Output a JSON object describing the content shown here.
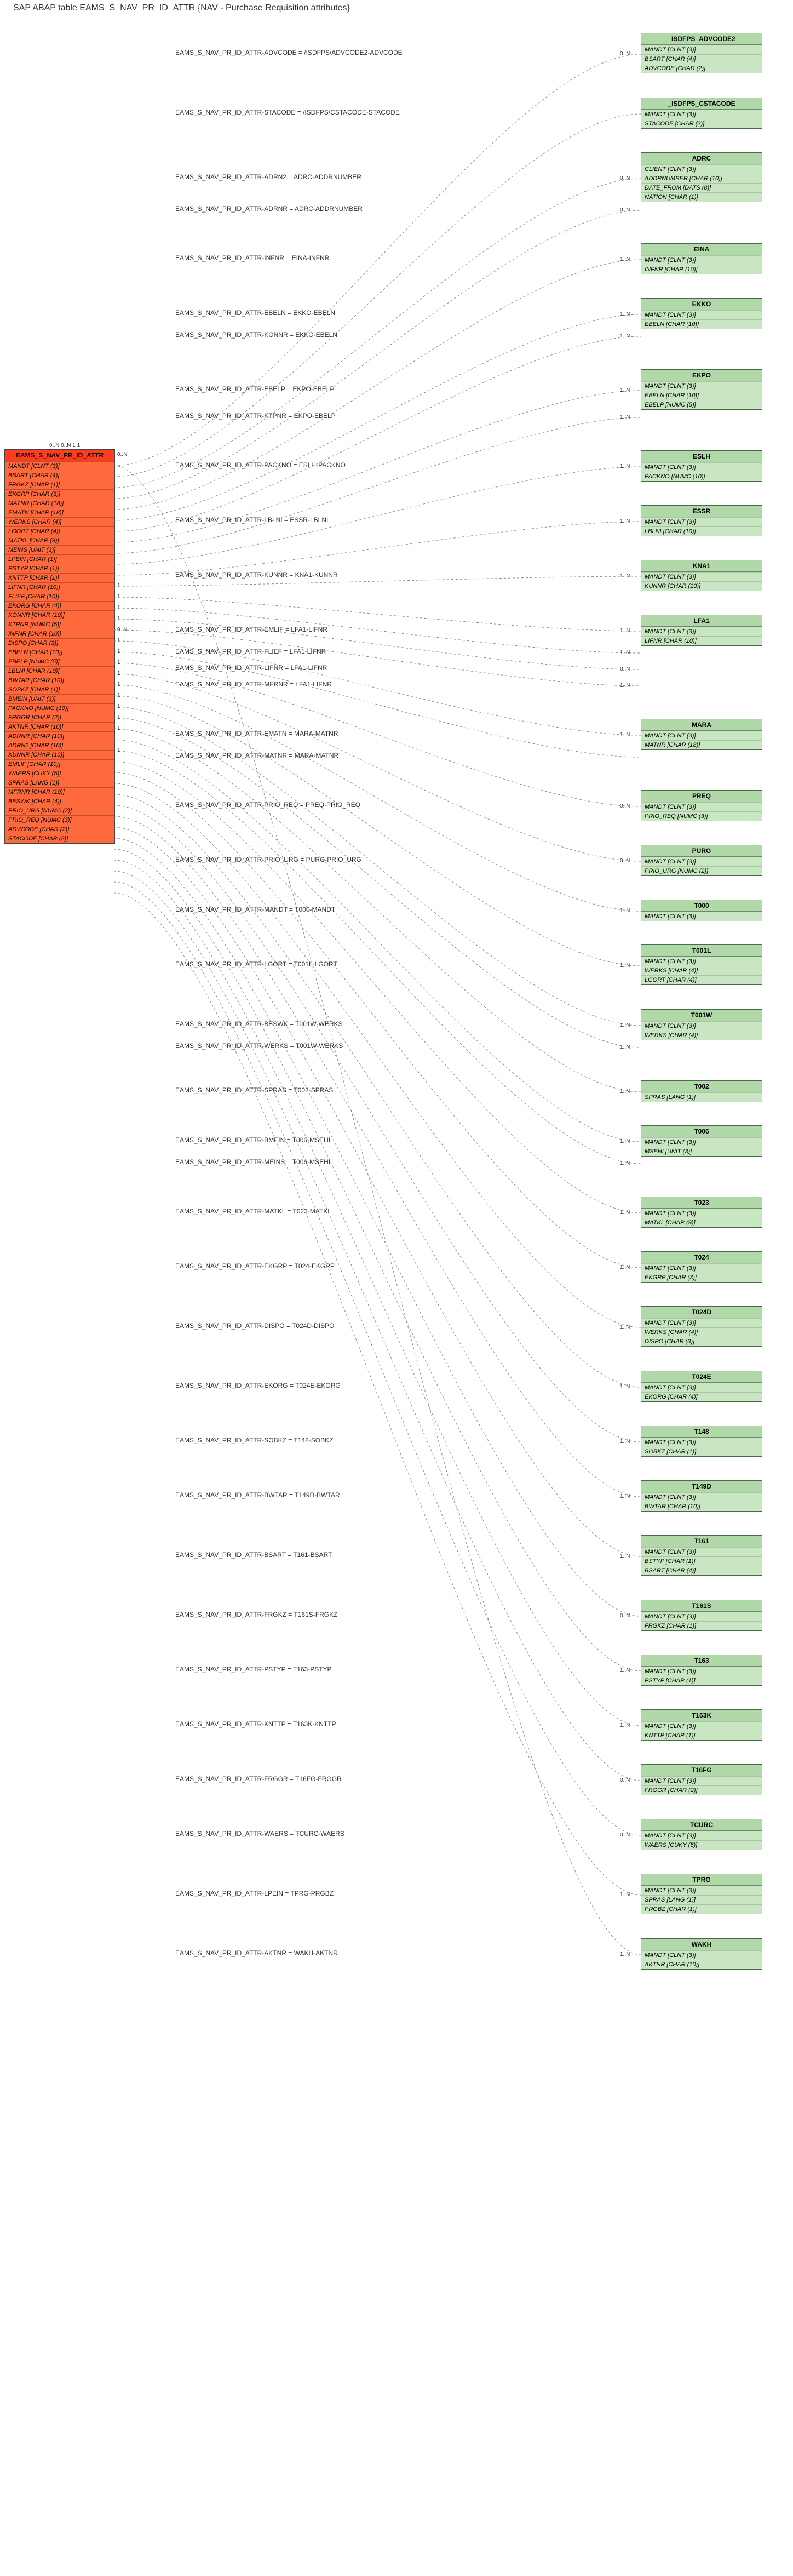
{
  "page_title": "SAP ABAP table EAMS_S_NAV_PR_ID_ATTR {NAV - Purchase Requisition attributes}",
  "main_table": {
    "name": "EAMS_S_NAV_PR_ID_ATTR",
    "fields": [
      "MANDT [CLNT (3)]",
      "BSART [CHAR (4)]",
      "FRGKZ [CHAR (1)]",
      "EKGRP [CHAR (3)]",
      "MATNR [CHAR (18)]",
      "EMATN [CHAR (18)]",
      "WERKS [CHAR (4)]",
      "LGORT [CHAR (4)]",
      "MATKL [CHAR (9)]",
      "MEINS [UNIT (3)]",
      "LPEIN [CHAR (1)]",
      "PSTYP [CHAR (1)]",
      "KNTTP [CHAR (1)]",
      "LIFNR [CHAR (10)]",
      "FLIEF [CHAR (10)]",
      "EKORG [CHAR (4)]",
      "KONNR [CHAR (10)]",
      "KTPNR [NUMC (5)]",
      "INFNR [CHAR (10)]",
      "DISPO [CHAR (3)]",
      "EBELN [CHAR (10)]",
      "EBELP [NUMC (5)]",
      "LBLNI [CHAR (10)]",
      "BWTAR [CHAR (10)]",
      "SOBKZ [CHAR (1)]",
      "BMEIN [UNIT (3)]",
      "PACKNO [NUMC (10)]",
      "FRGGR [CHAR (2)]",
      "AKTNR [CHAR (10)]",
      "ADRNR [CHAR (10)]",
      "ADRN2 [CHAR (10)]",
      "KUNNR [CHAR (10)]",
      "EMLIF [CHAR (10)]",
      "WAERS [CUKY (5)]",
      "SPRAS [LANG (1)]",
      "MFRNR [CHAR (10)]",
      "BESWK [CHAR (4)]",
      "PRIO_URG [NUMC (2)]",
      "PRIO_REQ [NUMC (3)]",
      "ADVCODE [CHAR (2)]",
      "STACODE [CHAR (2)]"
    ]
  },
  "relations": [
    {
      "label": "EAMS_S_NAV_PR_ID_ATTR-ADVCODE = /ISDFPS/ADVCODE2-ADVCODE",
      "card_src": "0..N",
      "card_tgt": "0..N",
      "target": {
        "name": "_ISDFPS_ADVCODE2",
        "fields": [
          "MANDT [CLNT (3)]",
          "BSART [CHAR (4)]",
          "ADVCODE [CHAR (2)]"
        ]
      }
    },
    {
      "label": "EAMS_S_NAV_PR_ID_ATTR-STACODE = /ISDFPS/CSTACODE-STACODE",
      "card_src": "",
      "card_tgt": "",
      "target": {
        "name": "_ISDFPS_CSTACODE",
        "fields": [
          "MANDT [CLNT (3)]",
          "STACODE [CHAR (2)]"
        ]
      }
    },
    {
      "label": "EAMS_S_NAV_PR_ID_ATTR-ADRN2 = ADRC-ADDRNUMBER",
      "card_src": "",
      "card_tgt": "0..N",
      "target": {
        "name": "ADRC",
        "fields": [
          "CLIENT [CLNT (3)]",
          "ADDRNUMBER [CHAR (10)]",
          "DATE_FROM [DATS (8)]",
          "NATION [CHAR (1)]"
        ]
      }
    },
    {
      "label": "EAMS_S_NAV_PR_ID_ATTR-ADRNR = ADRC-ADDRNUMBER",
      "card_src": "",
      "card_tgt": "0..N",
      "target": null
    },
    {
      "label": "EAMS_S_NAV_PR_ID_ATTR-INFNR = EINA-INFNR",
      "card_src": "",
      "card_tgt": "1..N",
      "target": {
        "name": "EINA",
        "fields": [
          "MANDT [CLNT (3)]",
          "INFNR [CHAR (10)]"
        ]
      }
    },
    {
      "label": "EAMS_S_NAV_PR_ID_ATTR-EBELN = EKKO-EBELN",
      "card_src": "",
      "card_tgt": "1..N",
      "target": {
        "name": "EKKO",
        "fields": [
          "MANDT [CLNT (3)]",
          "EBELN [CHAR (10)]"
        ]
      }
    },
    {
      "label": "EAMS_S_NAV_PR_ID_ATTR-KONNR = EKKO-EBELN",
      "card_src": "",
      "card_tgt": "1..N",
      "target": null
    },
    {
      "label": "EAMS_S_NAV_PR_ID_ATTR-EBELP = EKPO-EBELP",
      "card_src": "",
      "card_tgt": "1..N",
      "target": {
        "name": "EKPO",
        "fields": [
          "MANDT [CLNT (3)]",
          "EBELN [CHAR (10)]",
          "EBELP [NUMC (5)]"
        ]
      }
    },
    {
      "label": "EAMS_S_NAV_PR_ID_ATTR-KTPNR = EKPO-EBELP",
      "card_src": "",
      "card_tgt": "1..N",
      "target": null
    },
    {
      "label": "EAMS_S_NAV_PR_ID_ATTR-PACKNO = ESLH-PACKNO",
      "card_src": "",
      "card_tgt": "1..N",
      "target": {
        "name": "ESLH",
        "fields": [
          "MANDT [CLNT (3)]",
          "PACKNO [NUMC (10)]"
        ]
      }
    },
    {
      "label": "EAMS_S_NAV_PR_ID_ATTR-LBLNI = ESSR-LBLNI",
      "card_src": "",
      "card_tgt": "1..N",
      "target": {
        "name": "ESSR",
        "fields": [
          "MANDT [CLNT (3)]",
          "LBLNI [CHAR (10)]"
        ]
      }
    },
    {
      "label": "EAMS_S_NAV_PR_ID_ATTR-KUNNR = KNA1-KUNNR",
      "card_src": "",
      "card_tgt": "1..N",
      "target": {
        "name": "KNA1",
        "fields": [
          "MANDT [CLNT (3)]",
          "KUNNR [CHAR (10)]"
        ]
      }
    },
    {
      "label": "EAMS_S_NAV_PR_ID_ATTR-EMLIF = LFA1-LIFNR",
      "card_src": "1",
      "card_tgt": "1..N",
      "target": {
        "name": "LFA1",
        "fields": [
          "MANDT [CLNT (3)]",
          "LIFNR [CHAR (10)]"
        ]
      }
    },
    {
      "label": "EAMS_S_NAV_PR_ID_ATTR-FLIEF = LFA1-LIFNR",
      "card_src": "1",
      "card_tgt": "1..N",
      "target": null
    },
    {
      "label": "EAMS_S_NAV_PR_ID_ATTR-LIFNR = LFA1-LIFNR",
      "card_src": "1",
      "card_tgt": "0..N",
      "target": null
    },
    {
      "label": "EAMS_S_NAV_PR_ID_ATTR-MFRNR = LFA1-LIFNR",
      "card_src": "1",
      "card_tgt": "1..N",
      "target": null
    },
    {
      "label": "EAMS_S_NAV_PR_ID_ATTR-EMATN = MARA-MATNR",
      "card_src": "0..N",
      "card_tgt": "1..N",
      "target": {
        "name": "MARA",
        "fields": [
          "MANDT [CLNT (3)]",
          "MATNR [CHAR (18)]"
        ]
      }
    },
    {
      "label": "EAMS_S_NAV_PR_ID_ATTR-MATNR = MARA-MATNR",
      "card_src": "1",
      "card_tgt": "",
      "target": null
    },
    {
      "label": "EAMS_S_NAV_PR_ID_ATTR-PRIO_REQ = PREQ-PRIO_REQ",
      "card_src": "1",
      "card_tgt": "0..N",
      "target": {
        "name": "PREQ",
        "fields": [
          "MANDT [CLNT (3)]",
          "PRIO_REQ [NUMC (3)]"
        ]
      }
    },
    {
      "label": "EAMS_S_NAV_PR_ID_ATTR-PRIO_URG = PURG-PRIO_URG",
      "card_src": "1",
      "card_tgt": "0..N",
      "target": {
        "name": "PURG",
        "fields": [
          "MANDT [CLNT (3)]",
          "PRIO_URG [NUMC (2)]"
        ]
      }
    },
    {
      "label": "EAMS_S_NAV_PR_ID_ATTR-MANDT = T000-MANDT",
      "card_src": "1",
      "card_tgt": "1..N",
      "target": {
        "name": "T000",
        "fields": [
          "MANDT [CLNT (3)]"
        ]
      }
    },
    {
      "label": "EAMS_S_NAV_PR_ID_ATTR-LGORT = T001L-LGORT",
      "card_src": "1",
      "card_tgt": "1..N",
      "target": {
        "name": "T001L",
        "fields": [
          "MANDT [CLNT (3)]",
          "WERKS [CHAR (4)]",
          "LGORT [CHAR (4)]"
        ]
      }
    },
    {
      "label": "EAMS_S_NAV_PR_ID_ATTR-BESWK = T001W-WERKS",
      "card_src": "1",
      "card_tgt": "1..N",
      "target": {
        "name": "T001W",
        "fields": [
          "MANDT [CLNT (3)]",
          "WERKS [CHAR (4)]"
        ]
      }
    },
    {
      "label": "EAMS_S_NAV_PR_ID_ATTR-WERKS = T001W-WERKS",
      "card_src": "1",
      "card_tgt": "1..N",
      "target": null
    },
    {
      "label": "EAMS_S_NAV_PR_ID_ATTR-SPRAS = T002-SPRAS",
      "card_src": "1",
      "card_tgt": "1..N",
      "target": {
        "name": "T002",
        "fields": [
          "SPRAS [LANG (1)]"
        ]
      }
    },
    {
      "label": "EAMS_S_NAV_PR_ID_ATTR-BMEIN = T006-MSEHI",
      "card_src": "1",
      "card_tgt": "1..N",
      "target": {
        "name": "T006",
        "fields": [
          "MANDT [CLNT (3)]",
          "MSEHI [UNIT (3)]"
        ]
      }
    },
    {
      "label": "EAMS_S_NAV_PR_ID_ATTR-MEINS = T006-MSEHI",
      "card_src": "",
      "card_tgt": "1..N",
      "target": null
    },
    {
      "label": "EAMS_S_NAV_PR_ID_ATTR-MATKL = T023-MATKL",
      "card_src": "1",
      "card_tgt": "1..N",
      "target": {
        "name": "T023",
        "fields": [
          "MANDT [CLNT (3)]",
          "MATKL [CHAR (9)]"
        ]
      }
    },
    {
      "label": "EAMS_S_NAV_PR_ID_ATTR-EKGRP = T024-EKGRP",
      "card_src": "",
      "card_tgt": "1..N",
      "target": {
        "name": "T024",
        "fields": [
          "MANDT [CLNT (3)]",
          "EKGRP [CHAR (3)]"
        ]
      }
    },
    {
      "label": "EAMS_S_NAV_PR_ID_ATTR-DISPO = T024D-DISPO",
      "card_src": "",
      "card_tgt": "1..N",
      "target": {
        "name": "T024D",
        "fields": [
          "MANDT [CLNT (3)]",
          "WERKS [CHAR (4)]",
          "DISPO [CHAR (3)]"
        ]
      }
    },
    {
      "label": "EAMS_S_NAV_PR_ID_ATTR-EKORG = T024E-EKORG",
      "card_src": "",
      "card_tgt": "1..N",
      "target": {
        "name": "T024E",
        "fields": [
          "MANDT [CLNT (3)]",
          "EKORG [CHAR (4)]"
        ]
      }
    },
    {
      "label": "EAMS_S_NAV_PR_ID_ATTR-SOBKZ = T148-SOBKZ",
      "card_src": "",
      "card_tgt": "1..N",
      "target": {
        "name": "T148",
        "fields": [
          "MANDT [CLNT (3)]",
          "SOBKZ [CHAR (1)]"
        ]
      }
    },
    {
      "label": "EAMS_S_NAV_PR_ID_ATTR-BWTAR = T149D-BWTAR",
      "card_src": "",
      "card_tgt": "1..N",
      "target": {
        "name": "T149D",
        "fields": [
          "MANDT [CLNT (3)]",
          "BWTAR [CHAR (10)]"
        ]
      }
    },
    {
      "label": "EAMS_S_NAV_PR_ID_ATTR-BSART = T161-BSART",
      "card_src": "",
      "card_tgt": "1..N",
      "target": {
        "name": "T161",
        "fields": [
          "MANDT [CLNT (3)]",
          "BSTYP [CHAR (1)]",
          "BSART [CHAR (4)]"
        ]
      }
    },
    {
      "label": "EAMS_S_NAV_PR_ID_ATTR-FRGKZ = T161S-FRGKZ",
      "card_src": "",
      "card_tgt": "0..N",
      "target": {
        "name": "T161S",
        "fields": [
          "MANDT [CLNT (3)]",
          "FRGKZ [CHAR (1)]"
        ]
      }
    },
    {
      "label": "EAMS_S_NAV_PR_ID_ATTR-PSTYP = T163-PSTYP",
      "card_src": "",
      "card_tgt": "1..N",
      "target": {
        "name": "T163",
        "fields": [
          "MANDT [CLNT (3)]",
          "PSTYP [CHAR (1)]"
        ]
      }
    },
    {
      "label": "EAMS_S_NAV_PR_ID_ATTR-KNTTP = T163K-KNTTP",
      "card_src": "",
      "card_tgt": "1..N",
      "target": {
        "name": "T163K",
        "fields": [
          "MANDT [CLNT (3)]",
          "KNTTP [CHAR (1)]"
        ]
      }
    },
    {
      "label": "EAMS_S_NAV_PR_ID_ATTR-FRGGR = T16FG-FRGGR",
      "card_src": "",
      "card_tgt": "0..N",
      "target": {
        "name": "T16FG",
        "fields": [
          "MANDT [CLNT (3)]",
          "FRGGR [CHAR (2)]"
        ]
      }
    },
    {
      "label": "EAMS_S_NAV_PR_ID_ATTR-WAERS = TCURC-WAERS",
      "card_src": "",
      "card_tgt": "0..N",
      "target": {
        "name": "TCURC",
        "fields": [
          "MANDT [CLNT (3)]",
          "WAERS [CUKY (5)]"
        ]
      }
    },
    {
      "label": "EAMS_S_NAV_PR_ID_ATTR-LPEIN = TPRG-PRGBZ",
      "card_src": "",
      "card_tgt": "1..N",
      "target": {
        "name": "TPRG",
        "fields": [
          "MANDT [CLNT (3)]",
          "SPRAS [LANG (1)]",
          "PRGBZ [CHAR (1)]"
        ]
      }
    },
    {
      "label": "EAMS_S_NAV_PR_ID_ATTR-AKTNR = WAKH-AKTNR",
      "card_src": "",
      "card_tgt": "1..N",
      "target": {
        "name": "WAKH",
        "fields": [
          "MANDT [CLNT (3)]",
          "AKTNR [CHAR (10)]"
        ]
      }
    }
  ],
  "extra_cards": "0..N  0..N 1 1"
}
